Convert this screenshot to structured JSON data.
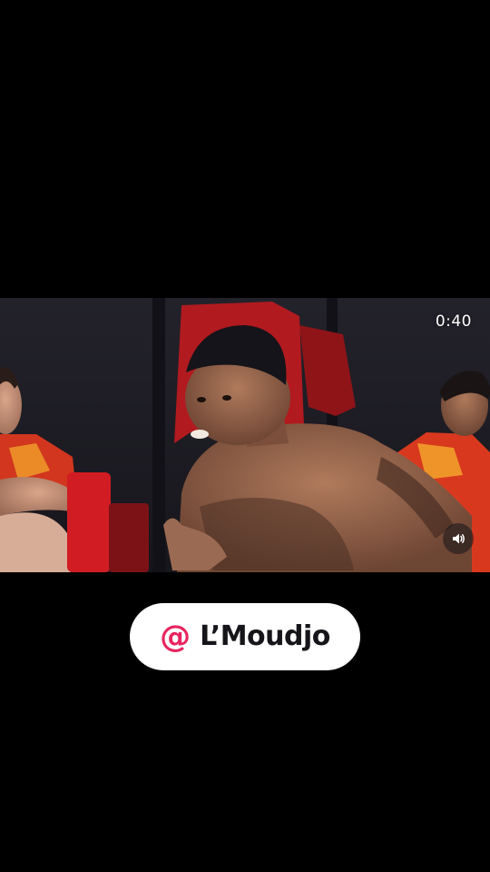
{
  "video": {
    "timer": "0:40",
    "volume_icon": "speaker-icon"
  },
  "handle": {
    "at_symbol": "@",
    "name": "L’Moudjo",
    "at_color": "#e8245e"
  }
}
